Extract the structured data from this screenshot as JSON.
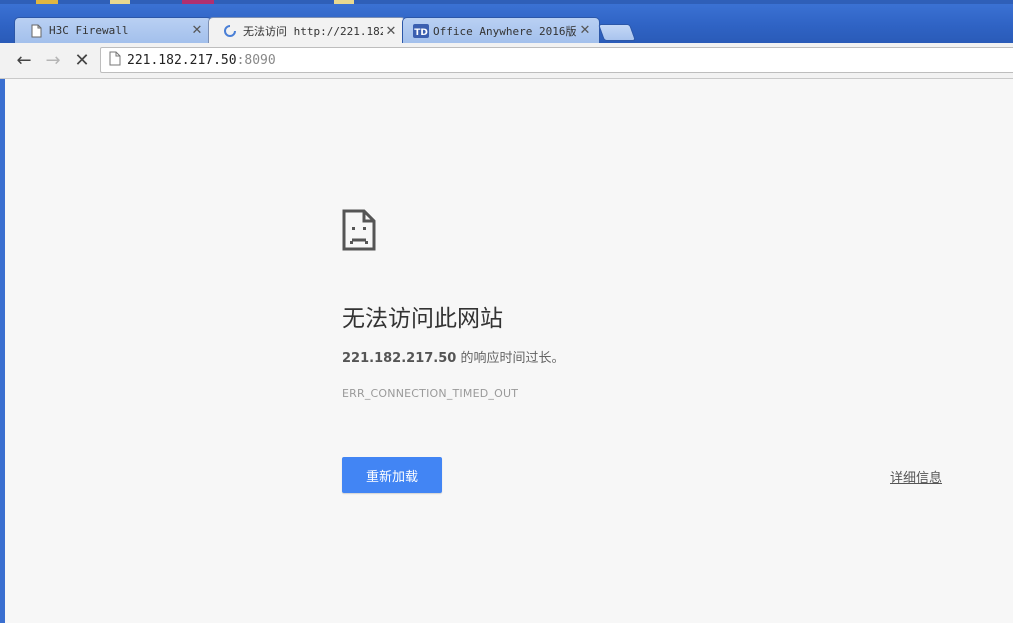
{
  "tabs": [
    {
      "title": "H3C Firewall",
      "state": "inactive",
      "favicon": "page-icon"
    },
    {
      "title": "无法访问 http://221.182",
      "state": "active",
      "favicon": "loading-spinner-icon"
    },
    {
      "title": "Office Anywhere 2016版",
      "state": "inactive",
      "favicon": "td-logo-icon"
    }
  ],
  "tab_close_glyph": "✕",
  "toolbar": {
    "back_glyph": "←",
    "forward_glyph": "→",
    "stop_glyph": "✕"
  },
  "address": {
    "host": "221.182.217.50",
    "port": ":8090"
  },
  "error": {
    "heading": "无法访问此网站",
    "host": "221.182.217.50",
    "summary_suffix": " 的响应时间过长。",
    "code": "ERR_CONNECTION_TIMED_OUT",
    "reload_label": "重新加载",
    "details_label": "详细信息"
  },
  "colors": {
    "reload_button": "#4285f4",
    "tabstrip": "#2f63c4"
  }
}
